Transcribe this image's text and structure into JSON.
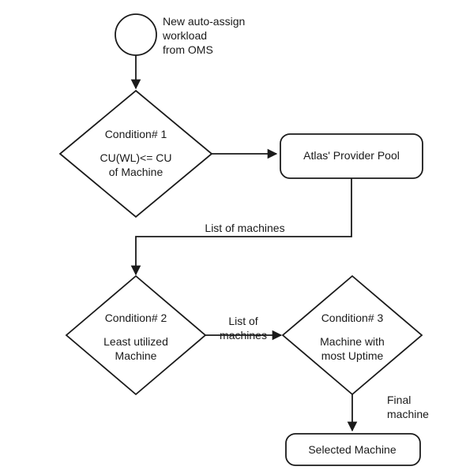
{
  "start": {
    "label_l1": "New auto-assign",
    "label_l2": "workload",
    "label_l3": "from OMS"
  },
  "cond1": {
    "title": "Condition# 1",
    "line1": "CU(WL)<= CU",
    "line2": "of Machine"
  },
  "provider_pool": {
    "label": "Atlas' Provider Pool"
  },
  "edge_pool_to_cond2": {
    "label": "List of machines"
  },
  "cond2": {
    "title": "Condition# 2",
    "line1": "Least utilized",
    "line2": "Machine"
  },
  "edge_cond2_to_cond3": {
    "label_l1": "List of",
    "label_l2": "machines"
  },
  "cond3": {
    "title": "Condition# 3",
    "line1": "Machine with",
    "line2": "most Uptime"
  },
  "edge_cond3_to_selected": {
    "label_l1": "Final",
    "label_l2": "machine"
  },
  "selected": {
    "label": "Selected Machine"
  }
}
